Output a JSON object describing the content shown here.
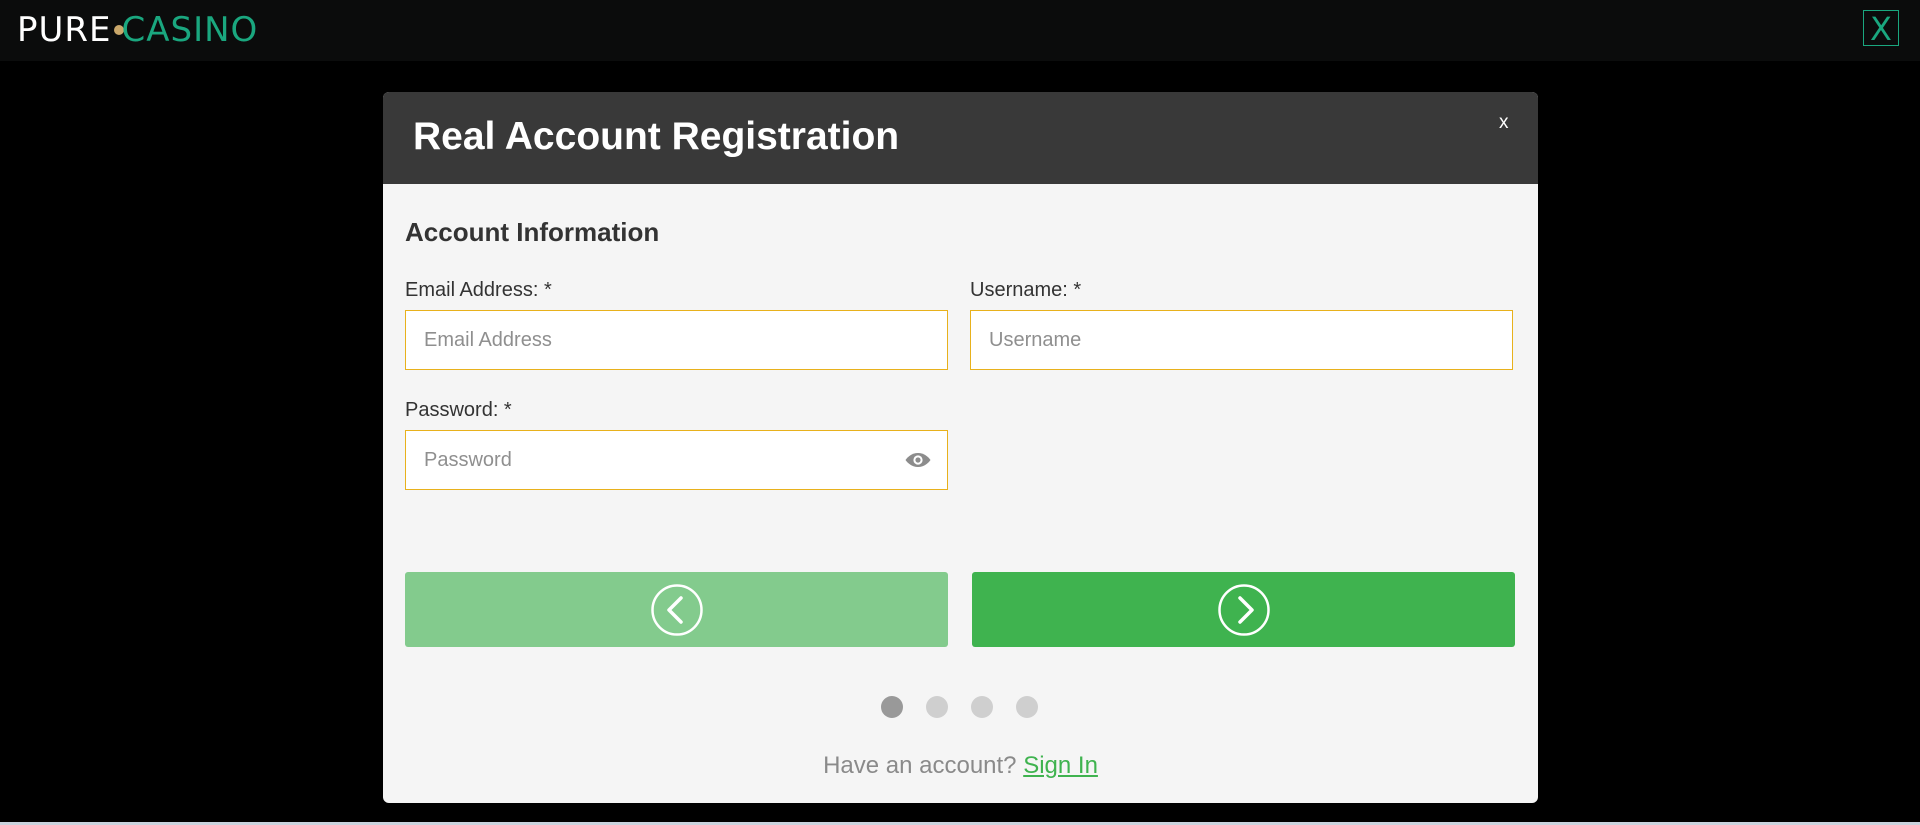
{
  "header": {
    "logo_part1": "PURE",
    "logo_part2": "CASINO",
    "close_label": "X"
  },
  "modal": {
    "title": "Real Account Registration",
    "close_label": "x",
    "section_title": "Account Information",
    "fields": {
      "email": {
        "label": "Email Address: *",
        "placeholder": "Email Address",
        "value": ""
      },
      "username": {
        "label": "Username: *",
        "placeholder": "Username",
        "value": ""
      },
      "password": {
        "label": "Password: *",
        "placeholder": "Password",
        "value": ""
      }
    },
    "buttons": {
      "prev_icon": "chevron-left-circle-icon",
      "next_icon": "chevron-right-circle-icon"
    },
    "steps": {
      "total": 4,
      "current": 1
    },
    "footer": {
      "prompt": "Have an account?",
      "link": "Sign In"
    }
  },
  "colors": {
    "accent_green": "#3fb34f",
    "disabled_green": "#83cb8d",
    "brand_teal": "#1aa77f",
    "input_border": "#e8b11c",
    "header_bg": "#393939"
  }
}
